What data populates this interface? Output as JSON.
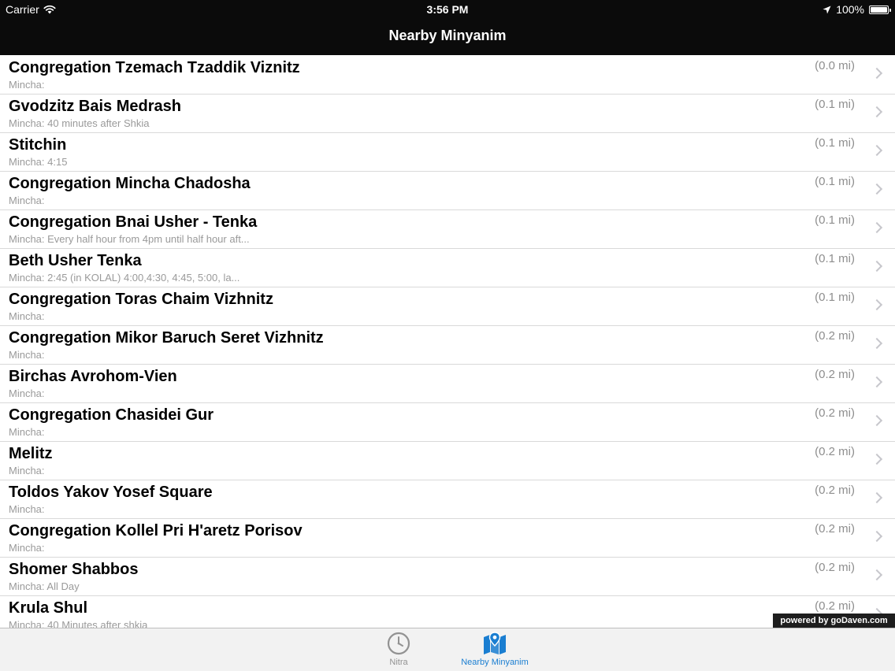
{
  "status_bar": {
    "carrier": "Carrier",
    "time": "3:56 PM",
    "battery": "100%",
    "battery_level": 1.0
  },
  "nav": {
    "title": "Nearby Minyanim"
  },
  "list": {
    "items": [
      {
        "name": "Congregation Tzemach Tzaddik Viznitz",
        "detail": "Mincha:",
        "distance": "(0.0 mi)"
      },
      {
        "name": "Gvodzitz Bais Medrash",
        "detail": "Mincha:  40 minutes after Shkia",
        "distance": "(0.1 mi)"
      },
      {
        "name": "Stitchin",
        "detail": "Mincha: 4:15",
        "distance": "(0.1 mi)"
      },
      {
        "name": "Congregation Mincha Chadosha",
        "detail": "Mincha:",
        "distance": "(0.1 mi)"
      },
      {
        "name": "Congregation Bnai Usher - Tenka",
        "detail": "Mincha:  Every half hour from 4pm until half hour aft...",
        "distance": "(0.1 mi)"
      },
      {
        "name": "Beth Usher Tenka",
        "detail": "Mincha:  2:45 (in KOLAL) 4:00,4:30, 4:45, 5:00, la...",
        "distance": "(0.1 mi)"
      },
      {
        "name": "Congregation Toras Chaim Vizhnitz",
        "detail": "Mincha:",
        "distance": "(0.1 mi)"
      },
      {
        "name": "Congregation Mikor Baruch Seret Vizhnitz",
        "detail": "Mincha:",
        "distance": "(0.2 mi)"
      },
      {
        "name": "Birchas Avrohom-Vien",
        "detail": "Mincha:",
        "distance": "(0.2 mi)"
      },
      {
        "name": "Congregation Chasidei Gur",
        "detail": "Mincha:",
        "distance": "(0.2 mi)"
      },
      {
        "name": "Melitz",
        "detail": "Mincha:",
        "distance": "(0.2 mi)"
      },
      {
        "name": "Toldos Yakov Yosef Square",
        "detail": "Mincha:",
        "distance": "(0.2 mi)"
      },
      {
        "name": "Congregation Kollel Pri H'aretz Porisov",
        "detail": "Mincha:",
        "distance": "(0.2 mi)"
      },
      {
        "name": "Shomer Shabbos",
        "detail": "Mincha:  All Day",
        "distance": "(0.2 mi)"
      },
      {
        "name": "Krula Shul",
        "detail": "Mincha:  40 Minutes after shkia",
        "distance": "(0.2 mi)"
      }
    ]
  },
  "powered_by": "powered by goDaven.com",
  "tabs": [
    {
      "label": "Nitra",
      "icon": "clock-icon",
      "selected": false
    },
    {
      "label": "Nearby Minyanim",
      "icon": "map-pin-icon",
      "selected": true
    }
  ],
  "colors": {
    "nav_background": "#0b0b0b",
    "tab_active": "#1a7ed1",
    "tab_inactive": "#929292"
  }
}
